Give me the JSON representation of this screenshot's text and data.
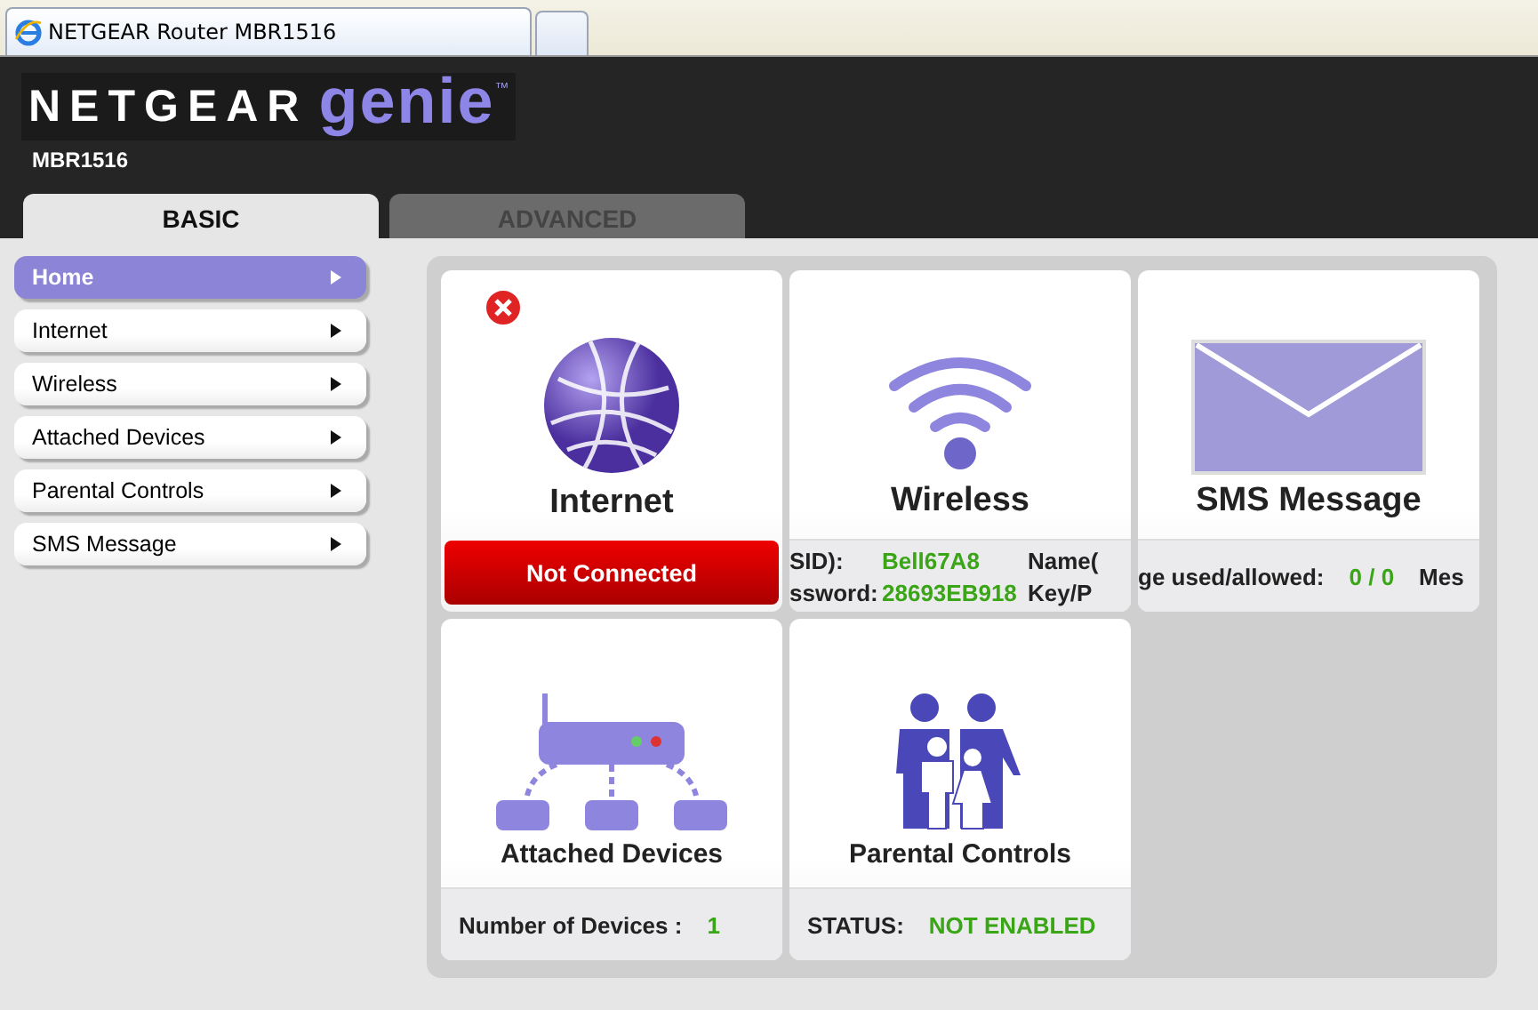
{
  "browser": {
    "tab_title": "NETGEAR Router MBR1516"
  },
  "header": {
    "brand": "NETGEAR",
    "product": "genie",
    "trademark": "™",
    "model": "MBR1516"
  },
  "tabs": [
    {
      "label": "BASIC",
      "selected": true
    },
    {
      "label": "ADVANCED",
      "selected": false
    }
  ],
  "sidebar": {
    "items": [
      {
        "label": "Home",
        "selected": true
      },
      {
        "label": "Internet",
        "selected": false
      },
      {
        "label": "Wireless",
        "selected": false
      },
      {
        "label": "Attached Devices",
        "selected": false
      },
      {
        "label": "Parental Controls",
        "selected": false
      },
      {
        "label": "SMS Message",
        "selected": false
      }
    ]
  },
  "tiles": [
    {
      "kind": "internet",
      "title": "Internet",
      "error": true,
      "status": {
        "text": "Not Connected",
        "connected": false
      }
    },
    {
      "kind": "wireless",
      "title": "Wireless",
      "rows": [
        [
          {
            "text": "SID):",
            "kind": "label"
          },
          {
            "text": "Bell67A8",
            "kind": "value"
          },
          {
            "text": "Name(",
            "kind": "label"
          }
        ],
        [
          {
            "text": "ssword:",
            "kind": "label"
          },
          {
            "text": "28693EB918",
            "kind": "value"
          },
          {
            "text": "Key/P",
            "kind": "label"
          }
        ]
      ]
    },
    {
      "kind": "sms",
      "title": "SMS Message",
      "rows": [
        [
          {
            "text": "ge used/allowed:",
            "kind": "label"
          },
          {
            "text": "0 / 0",
            "kind": "value"
          },
          {
            "text": "Mes",
            "kind": "label"
          }
        ]
      ]
    },
    {
      "kind": "devices",
      "title": "Attached Devices",
      "rows": [
        [
          {
            "text": "Number of Devices :",
            "kind": "label"
          },
          {
            "text": "1",
            "kind": "value"
          }
        ]
      ]
    },
    {
      "kind": "parental",
      "title": "Parental Controls",
      "rows": [
        [
          {
            "text": "STATUS:",
            "kind": "label"
          },
          {
            "text": "NOT ENABLED",
            "kind": "value"
          }
        ]
      ]
    }
  ]
}
